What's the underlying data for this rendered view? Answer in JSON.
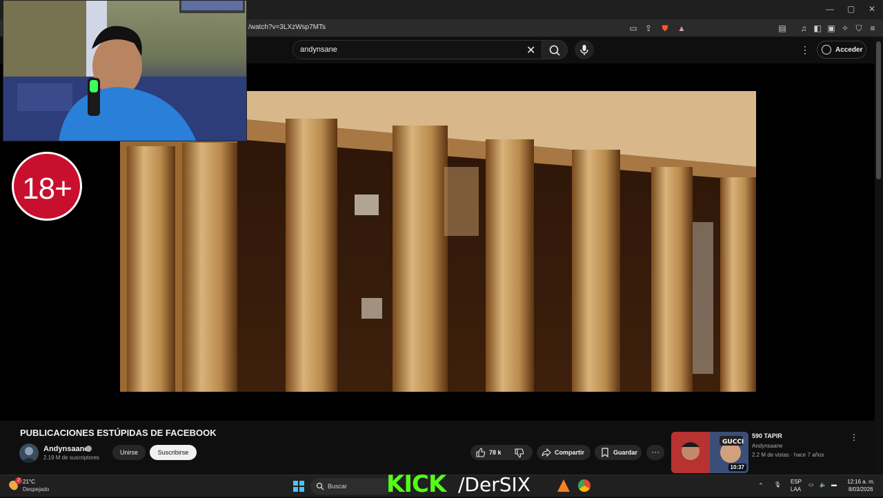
{
  "browser": {
    "url": "/watch?v=3LXzWsp7MTs"
  },
  "header": {
    "search_query": "andynsane",
    "signin_label": "Acceder"
  },
  "overlay": {
    "age_badge": "18+"
  },
  "video": {
    "title": "PUBLICACIONES ESTÚPIDAS DE FACEBOOK",
    "channel": "Andynsaane",
    "subscribers": "2.19 M de suscriptores",
    "join_label": "Unirse",
    "subscribe_label": "Suscribirse",
    "likes": "78 k",
    "share_label": "Compartir",
    "save_label": "Guardar"
  },
  "recommendation": {
    "title": "590 TAPIR",
    "channel": "Andynsaane",
    "meta": "2.2 M de vistas · hace 7 años",
    "duration": "10:37"
  },
  "stream_overlay": {
    "kick_word": "KICK",
    "handle": "/DerSIX"
  },
  "taskbar": {
    "weather_temp": "21°C",
    "weather_desc": "Despejado",
    "search_label": "Buscar",
    "lang_top": "ESP",
    "lang_bottom": "LAA",
    "time": "12:16 a. m.",
    "date": "8/03/2026",
    "weather_badge": "2"
  },
  "colors": {
    "youtube_bg": "#0f0f0f",
    "age_badge": "#c8102e",
    "kick_green": "#53fc18"
  }
}
